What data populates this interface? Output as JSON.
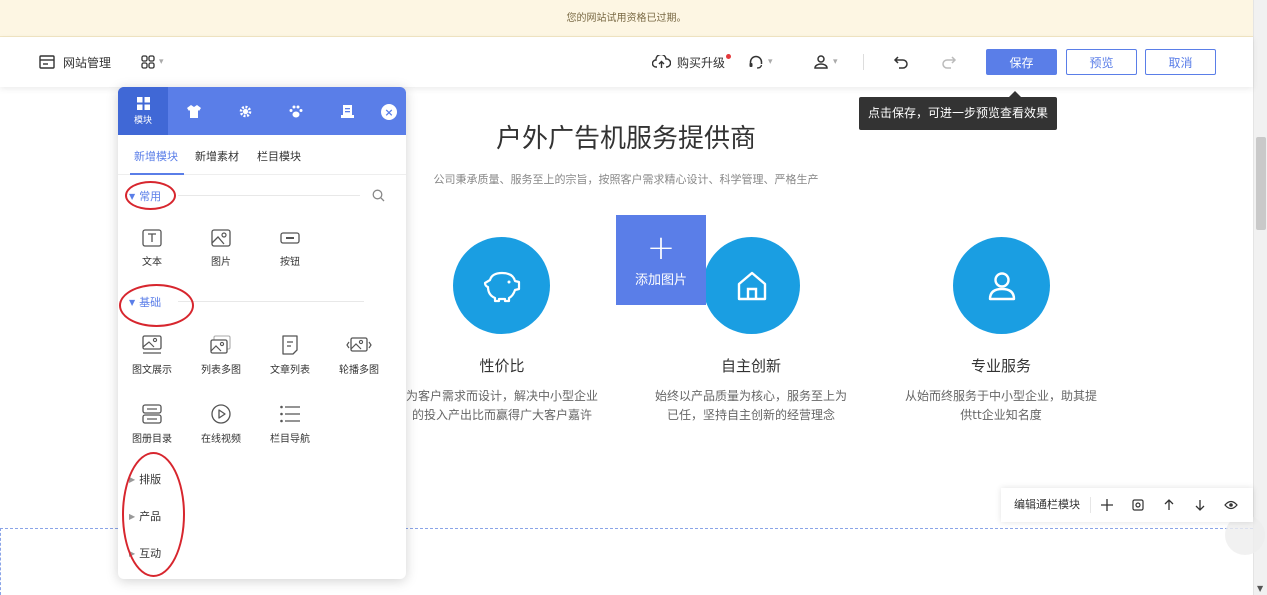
{
  "notice": {
    "text": "您的网站试用资格已过期。"
  },
  "toolbar": {
    "site_manage": "网站管理",
    "upgrade": "购买升级",
    "save": "保存",
    "preview": "预览",
    "cancel": "取消"
  },
  "tooltip": {
    "text": "点击保存，可进一步预览查看效果"
  },
  "page": {
    "title": "户外广告机服务提供商",
    "subtitle": "公司秉承质量、服务至上的宗旨，按照客户需求精心设计、科学管理、严格生产",
    "add_image": "添加图片",
    "features": [
      {
        "title": "性价比",
        "desc_line1": "为客户需求而设计，解决中小型企业",
        "desc_line2": "的投入产出比而赢得广大客户嘉许"
      },
      {
        "title": "自主创新",
        "desc_line1": "始终以产品质量为核心，服务至上为",
        "desc_line2": "已任，坚持自主创新的经营理念"
      },
      {
        "title": "专业服务",
        "desc_line1": "从始而终服务于中小型企业，助其提",
        "desc_line2": "供tt企业知名度"
      }
    ]
  },
  "edit_bar": {
    "label": "编辑通栏模块"
  },
  "panel": {
    "head_tab_module": "模块",
    "subtabs": [
      "新增模块",
      "新增素材",
      "栏目模块"
    ],
    "sections": {
      "common": "常用",
      "basic": "基础",
      "layout": "排版",
      "product": "产品",
      "interact": "互动"
    },
    "common_modules": [
      "文本",
      "图片",
      "按钮"
    ],
    "basic_modules": [
      "图文展示",
      "列表多图",
      "文章列表",
      "轮播多图",
      "图册目录",
      "在线视频",
      "栏目导航"
    ]
  },
  "colors": {
    "accent": "#5a7ee8",
    "feature_circle": "#1a9ee2",
    "annotation": "#d7262e"
  }
}
